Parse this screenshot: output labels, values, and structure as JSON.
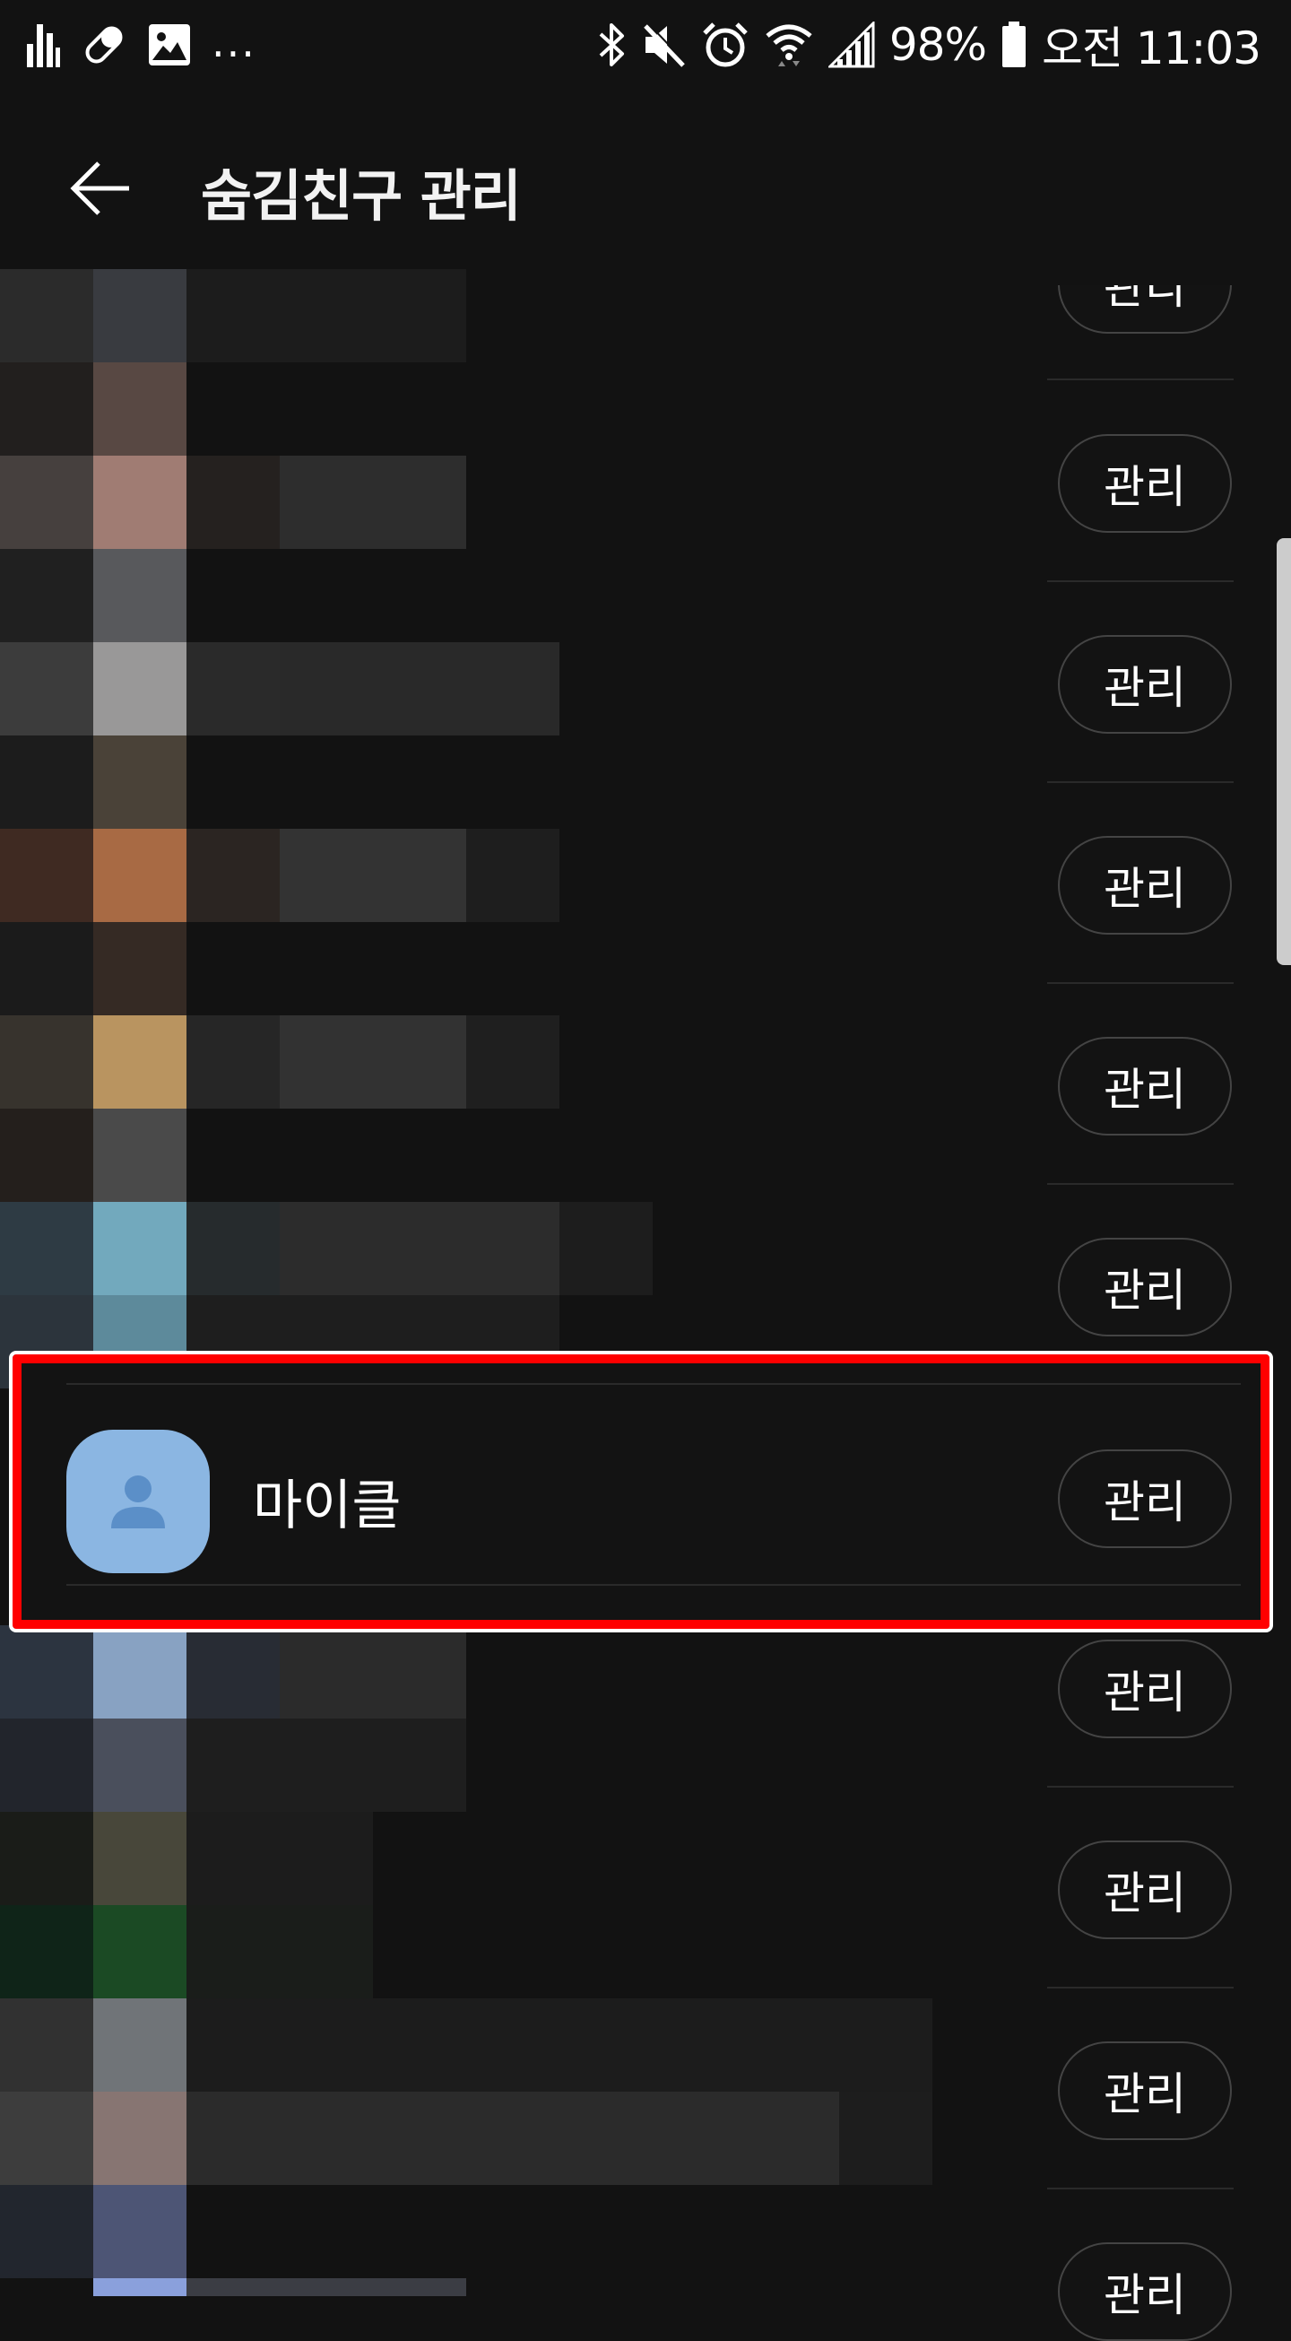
{
  "status_bar": {
    "battery_percent": "98%",
    "time": "오전 11:03",
    "more_indicator": "...",
    "left_icons": [
      "equalizer-icon",
      "pill-icon",
      "image-icon"
    ],
    "right_icons": [
      "bluetooth-icon",
      "mute-icon",
      "alarm-icon",
      "wifi-icon",
      "signal-icon",
      "battery-icon"
    ]
  },
  "app_bar": {
    "title": "숨김친구 관리",
    "back_icon": "arrow-left-icon"
  },
  "list": {
    "button_label": "관리",
    "highlighted_contact": {
      "name": "마이클",
      "avatar_icon": "person-icon",
      "avatar_color": "#8bb6e2"
    },
    "highlight_color": "#ff0000"
  }
}
